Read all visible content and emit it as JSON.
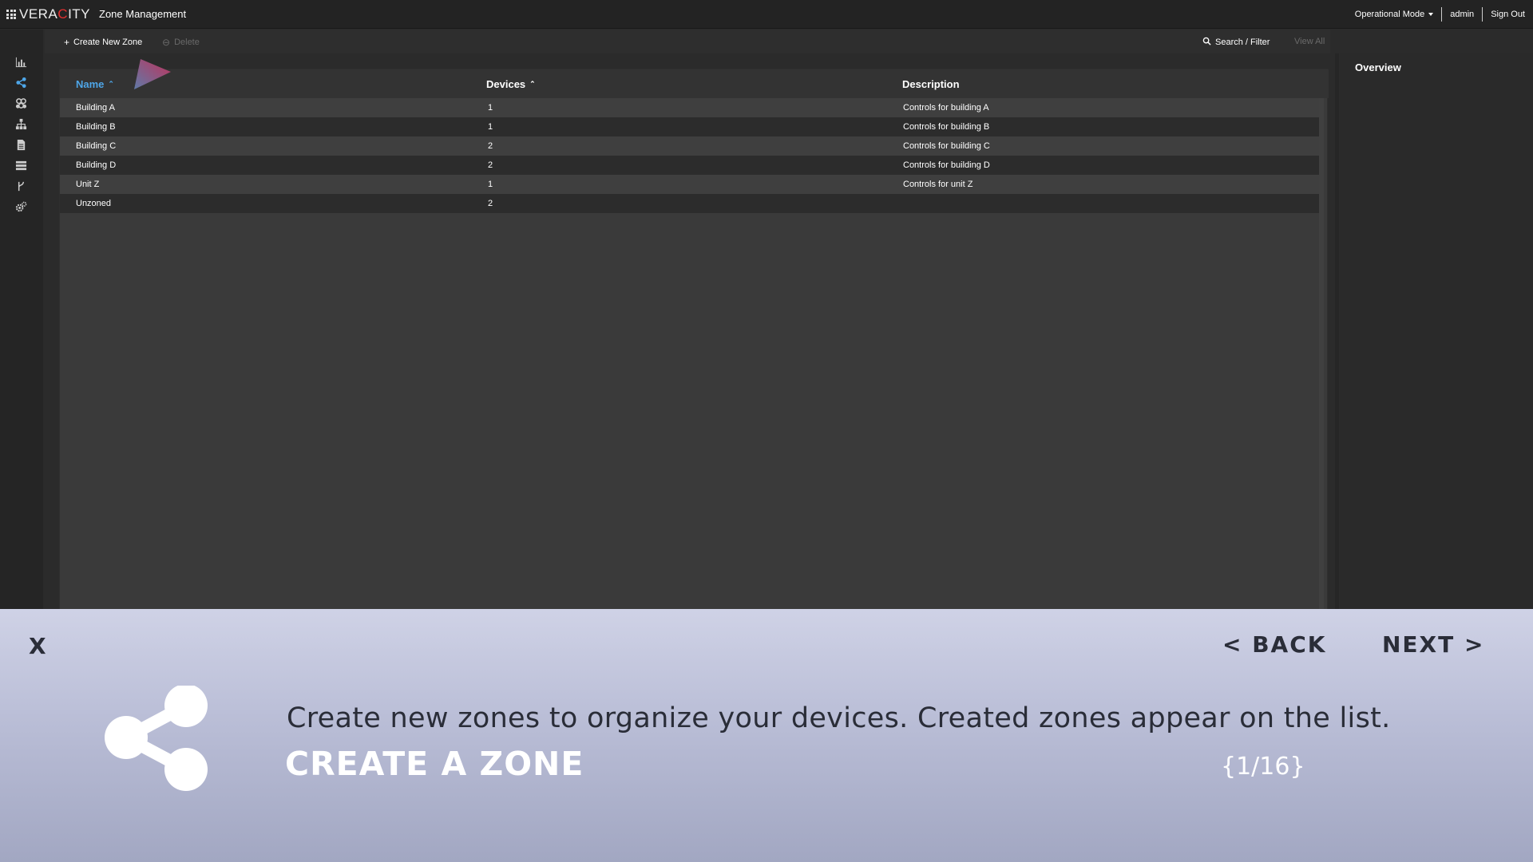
{
  "header": {
    "logo_prefix": "VERA",
    "logo_accent": "C",
    "logo_suffix": "ITY",
    "title": "Zone Management",
    "mode_label": "Operational Mode",
    "user": "admin",
    "signout": "Sign Out"
  },
  "sidebar": {
    "icons": [
      "bar-chart-icon",
      "share-icon",
      "devices-icon",
      "hierarchy-icon",
      "document-icon",
      "list-icon",
      "branch-icon",
      "settings-icon"
    ]
  },
  "toolbar": {
    "create_label": "Create New Zone",
    "delete_label": "Delete",
    "search_label": "Search / Filter",
    "view_all_label": "View All"
  },
  "table": {
    "columns": [
      "Name",
      "Devices",
      "Description"
    ],
    "rows": [
      {
        "name": "Building A",
        "devices": "1",
        "description": "Controls for building A"
      },
      {
        "name": "Building B",
        "devices": "1",
        "description": "Controls for building B"
      },
      {
        "name": "Building C",
        "devices": "2",
        "description": "Controls for building C"
      },
      {
        "name": "Building D",
        "devices": "2",
        "description": "Controls for building D"
      },
      {
        "name": "Unit Z",
        "devices": "1",
        "description": "Controls for unit Z"
      },
      {
        "name": "Unzoned",
        "devices": "2",
        "description": ""
      }
    ]
  },
  "overview": {
    "title": "Overview"
  },
  "tour": {
    "close": "X",
    "back": "< BACK",
    "next": "NEXT >",
    "description": "Create new zones to organize your devices. Created zones appear on the list.",
    "title": "CREATE A ZONE",
    "counter": "{1/16}",
    "icon": "share-icon"
  },
  "colors": {
    "accent_blue": "#4ea6e8",
    "logo_red": "#e53030",
    "tour_text": "#2a2d38"
  }
}
